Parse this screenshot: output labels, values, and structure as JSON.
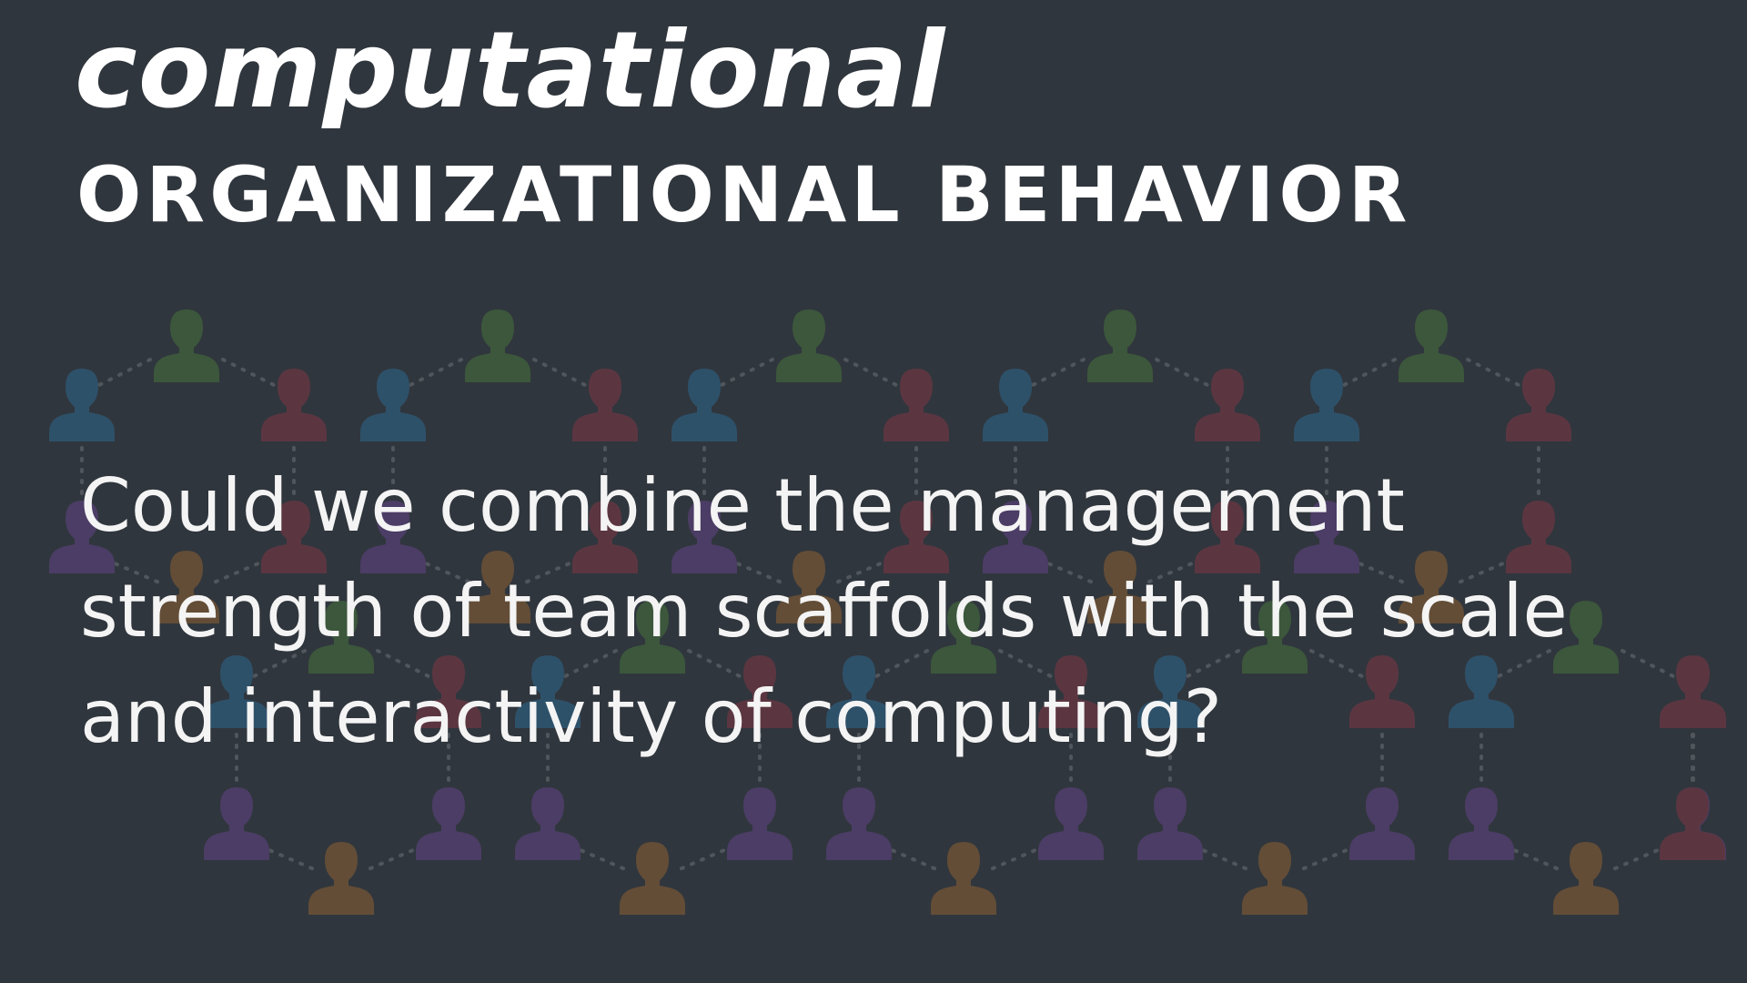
{
  "slide": {
    "title_line1": "computational",
    "title_line2": "ORGANIZATIONAL BEHAVIOR",
    "question_lines": [
      "Could we combine the management",
      "strength of team scaffolds with the scale",
      "and interactivity of computing?"
    ]
  },
  "background": {
    "icon": "person-icon",
    "colors": {
      "green": "#5aa53c",
      "blue": "#2b8fd1",
      "red": "#c0394b",
      "purple": "#8a4fc2",
      "orange": "#d8842a"
    }
  }
}
